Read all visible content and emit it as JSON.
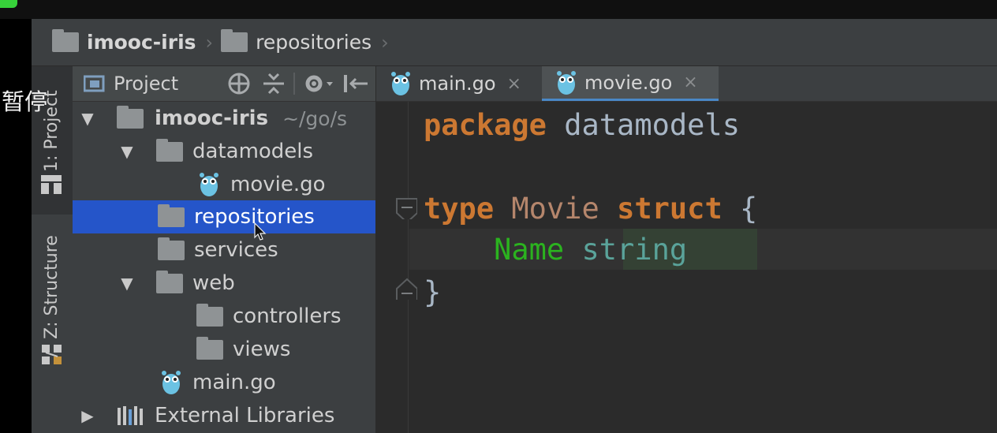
{
  "overlay": {
    "pause_label": "暂停"
  },
  "breadcrumb": {
    "items": [
      {
        "label": "imooc-iris",
        "bold": true
      },
      {
        "label": "repositories",
        "bold": false
      }
    ]
  },
  "tool_window_strip": {
    "project_tab": "1: Project",
    "structure_tab": "Z: Structure"
  },
  "project_panel": {
    "title": "Project",
    "tree": [
      {
        "label": "imooc-iris",
        "path": "~/go/s",
        "type": "folder",
        "expanded": true,
        "depth": 0,
        "bold": true
      },
      {
        "label": "datamodels",
        "type": "folder",
        "expanded": true,
        "depth": 1
      },
      {
        "label": "movie.go",
        "type": "go-file",
        "depth": 2
      },
      {
        "label": "repositories",
        "type": "folder",
        "depth": 1,
        "selected": true
      },
      {
        "label": "services",
        "type": "folder",
        "depth": 1
      },
      {
        "label": "web",
        "type": "folder",
        "expanded": true,
        "depth": 1
      },
      {
        "label": "controllers",
        "type": "folder",
        "depth": 2
      },
      {
        "label": "views",
        "type": "folder",
        "depth": 2
      },
      {
        "label": "main.go",
        "type": "go-file",
        "depth": 1
      },
      {
        "label": "External Libraries",
        "type": "library",
        "expanded": false,
        "depth": 0
      }
    ]
  },
  "editor": {
    "tabs": [
      {
        "label": "main.go",
        "active": false,
        "close": "×"
      },
      {
        "label": "movie.go",
        "active": true,
        "close": "×"
      }
    ],
    "code": {
      "line1": {
        "keyword": "package",
        "name": "datamodels"
      },
      "line3": {
        "keyword": "type",
        "name": "Movie",
        "keyword2": "struct",
        "brace": "{"
      },
      "line4": {
        "field": "Name",
        "type": "string"
      },
      "line5": {
        "brace": "}"
      }
    }
  },
  "colors": {
    "selection": "#2555c9",
    "keyword": "#cc7832",
    "field": "#2bb31f",
    "type": "#5aa39a",
    "panel_bg": "#3c3f41",
    "editor_bg": "#2b2b2b"
  }
}
